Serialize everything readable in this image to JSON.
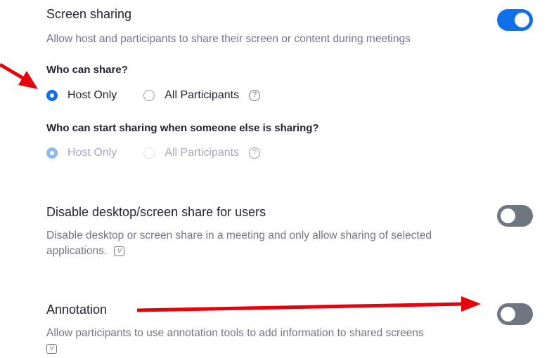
{
  "screen_sharing": {
    "title": "Screen sharing",
    "description": "Allow host and participants to share their screen or content during meetings",
    "toggle_on": true,
    "who_can_share": {
      "label": "Who can share?",
      "options": [
        "Host Only",
        "All Participants"
      ],
      "selected": "Host Only",
      "help_glyph": "?"
    },
    "who_can_start": {
      "label": "Who can start sharing when someone else is sharing?",
      "options": [
        "Host Only",
        "All Participants"
      ],
      "selected": "Host Only",
      "help_glyph": "?",
      "disabled": true
    }
  },
  "disable_desktop_share": {
    "title": "Disable desktop/screen share for users",
    "description": "Disable desktop or screen share in a meeting and only allow sharing of selected applications.",
    "badge_glyph": "V",
    "toggle_on": false
  },
  "annotation": {
    "title": "Annotation",
    "description": "Allow participants to use annotation tools to add information to shared screens",
    "badge_glyph": "V",
    "toggle_on": false
  },
  "colors": {
    "accent": "#0e71eb",
    "toggle_off": "#6e7680",
    "arrow": "#e8000b",
    "muted_text": "#747487"
  }
}
